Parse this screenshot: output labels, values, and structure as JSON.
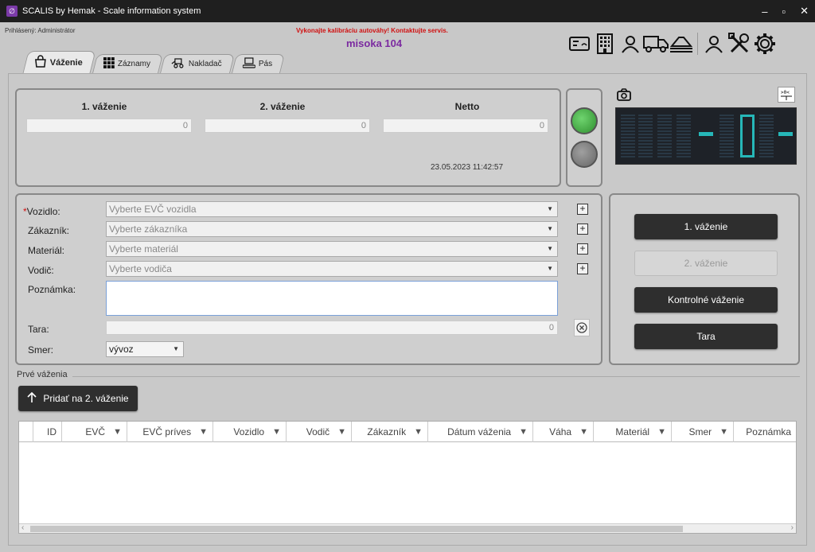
{
  "window": {
    "title": "SCALIS by Hemak - Scale information system",
    "minimize": "–",
    "maximize": "▫",
    "close": "✕"
  },
  "user_line": "Prihlásený: Administrátor",
  "warning": "Vykonajte kalibráciu autováhy! Kontaktujte servis.",
  "scale_name": "misoka 104",
  "toolbar_icons": [
    "card-reader-icon",
    "building-icon",
    "user-icon",
    "truck-icon",
    "scale-platform-icon",
    "admin-user-icon",
    "tools-icon",
    "settings-icon"
  ],
  "tabs": [
    {
      "label": "Váženie",
      "active": true
    },
    {
      "label": "Záznamy",
      "active": false
    },
    {
      "label": "Nakladač",
      "active": false
    },
    {
      "label": "Pás",
      "active": false
    }
  ],
  "weighing": {
    "first_label": "1. váženie",
    "first_value": "0",
    "second_label": "2. váženie",
    "second_value": "0",
    "netto_label": "Netto",
    "netto_value": "0",
    "datetime": "23.05.2023 11:42:57"
  },
  "colors": {
    "lamp_green": "#3fae3f",
    "lamp_gray": "#7a7a7a",
    "accent": "#7b2aa0",
    "warning": "#d01010",
    "display_digit": "#27c8c8"
  },
  "display": {
    "reading": "-0-"
  },
  "form": {
    "vehicle_label": "Vozidlo:",
    "vehicle_placeholder": "Vyberte EVČ vozidla",
    "customer_label": "Zákazník:",
    "customer_placeholder": "Vyberte zákazníka",
    "material_label": "Materiál:",
    "material_placeholder": "Vyberte materiál",
    "driver_label": "Vodič:",
    "driver_placeholder": "Vyberte vodiča",
    "note_label": "Poznámka:",
    "tara_label": "Tara:",
    "tara_value": "0",
    "direction_label": "Smer:",
    "direction_value": "vývoz"
  },
  "actions": {
    "first_weighing": "1. váženie",
    "second_weighing": "2. váženie",
    "control_weighing": "Kontrolné váženie",
    "tara": "Tara"
  },
  "first_weighings": {
    "section_label": "Prvé váženia",
    "add_button": "Pridať na 2. váženie",
    "columns": [
      "ID",
      "EVČ",
      "EVČ príves",
      "Vozidlo",
      "Vodič",
      "Zákazník",
      "Dátum váženia",
      "Váha",
      "Materiál",
      "Smer",
      "Poznámka"
    ],
    "rows": []
  }
}
